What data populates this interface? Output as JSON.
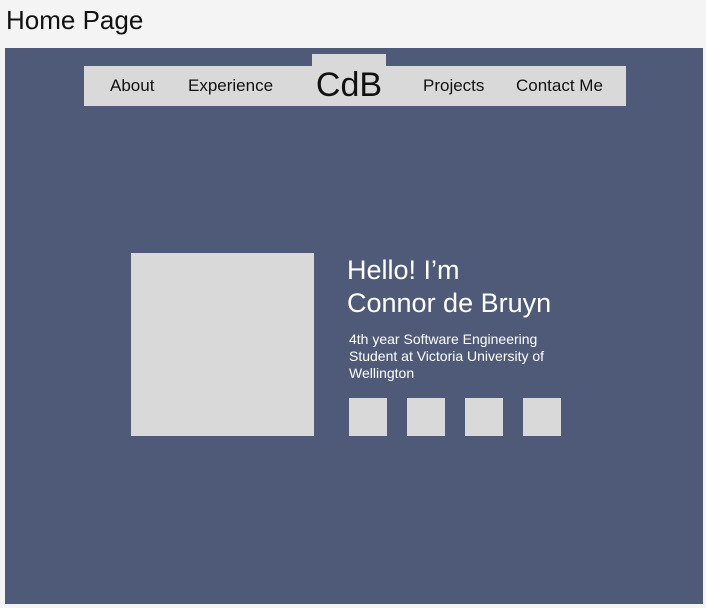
{
  "page": {
    "label": "Home Page"
  },
  "nav": {
    "logo": "CdB",
    "items": [
      {
        "label": "About"
      },
      {
        "label": "Experience"
      },
      {
        "label": "Projects"
      },
      {
        "label": "Contact Me"
      }
    ]
  },
  "hero": {
    "headline_line1": "Hello! I’m",
    "headline_line2": "Connor de Bruyn",
    "subtitle": "4th year Software Engineering Student at Victoria University of Wellington"
  },
  "colors": {
    "background": "#4e5a78",
    "placeholder": "#d9d9d9",
    "text_light": "#ffffff"
  }
}
